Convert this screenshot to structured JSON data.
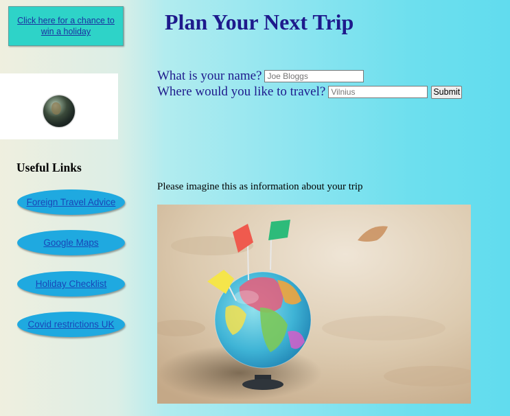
{
  "promo": {
    "label": "Click here for a chance to win a holiday"
  },
  "logo": {
    "icon": "globe-icon"
  },
  "title": "Plan Your Next Trip",
  "form": {
    "name_label": "What is your name?",
    "name_placeholder": "Joe Bloggs",
    "destination_label": "Where would you like to travel?",
    "destination_placeholder": "Vilnius",
    "submit_label": "Submit"
  },
  "sidebar": {
    "heading": "Useful Links",
    "links": [
      {
        "label": "Foreign Travel Advice"
      },
      {
        "label": "Google Maps"
      },
      {
        "label": "Holiday Checklist"
      },
      {
        "label": "Covid restrictions UK"
      }
    ]
  },
  "content": {
    "info_text": "Please imagine this as information about your trip"
  },
  "image": {
    "subject": "globe-with-flags-on-sand-image"
  },
  "colors": {
    "title": "#1e1a8c",
    "promo_bg": "#2ed3c8",
    "link_pill": "#1fa9e0",
    "link_text": "#1846b8"
  }
}
